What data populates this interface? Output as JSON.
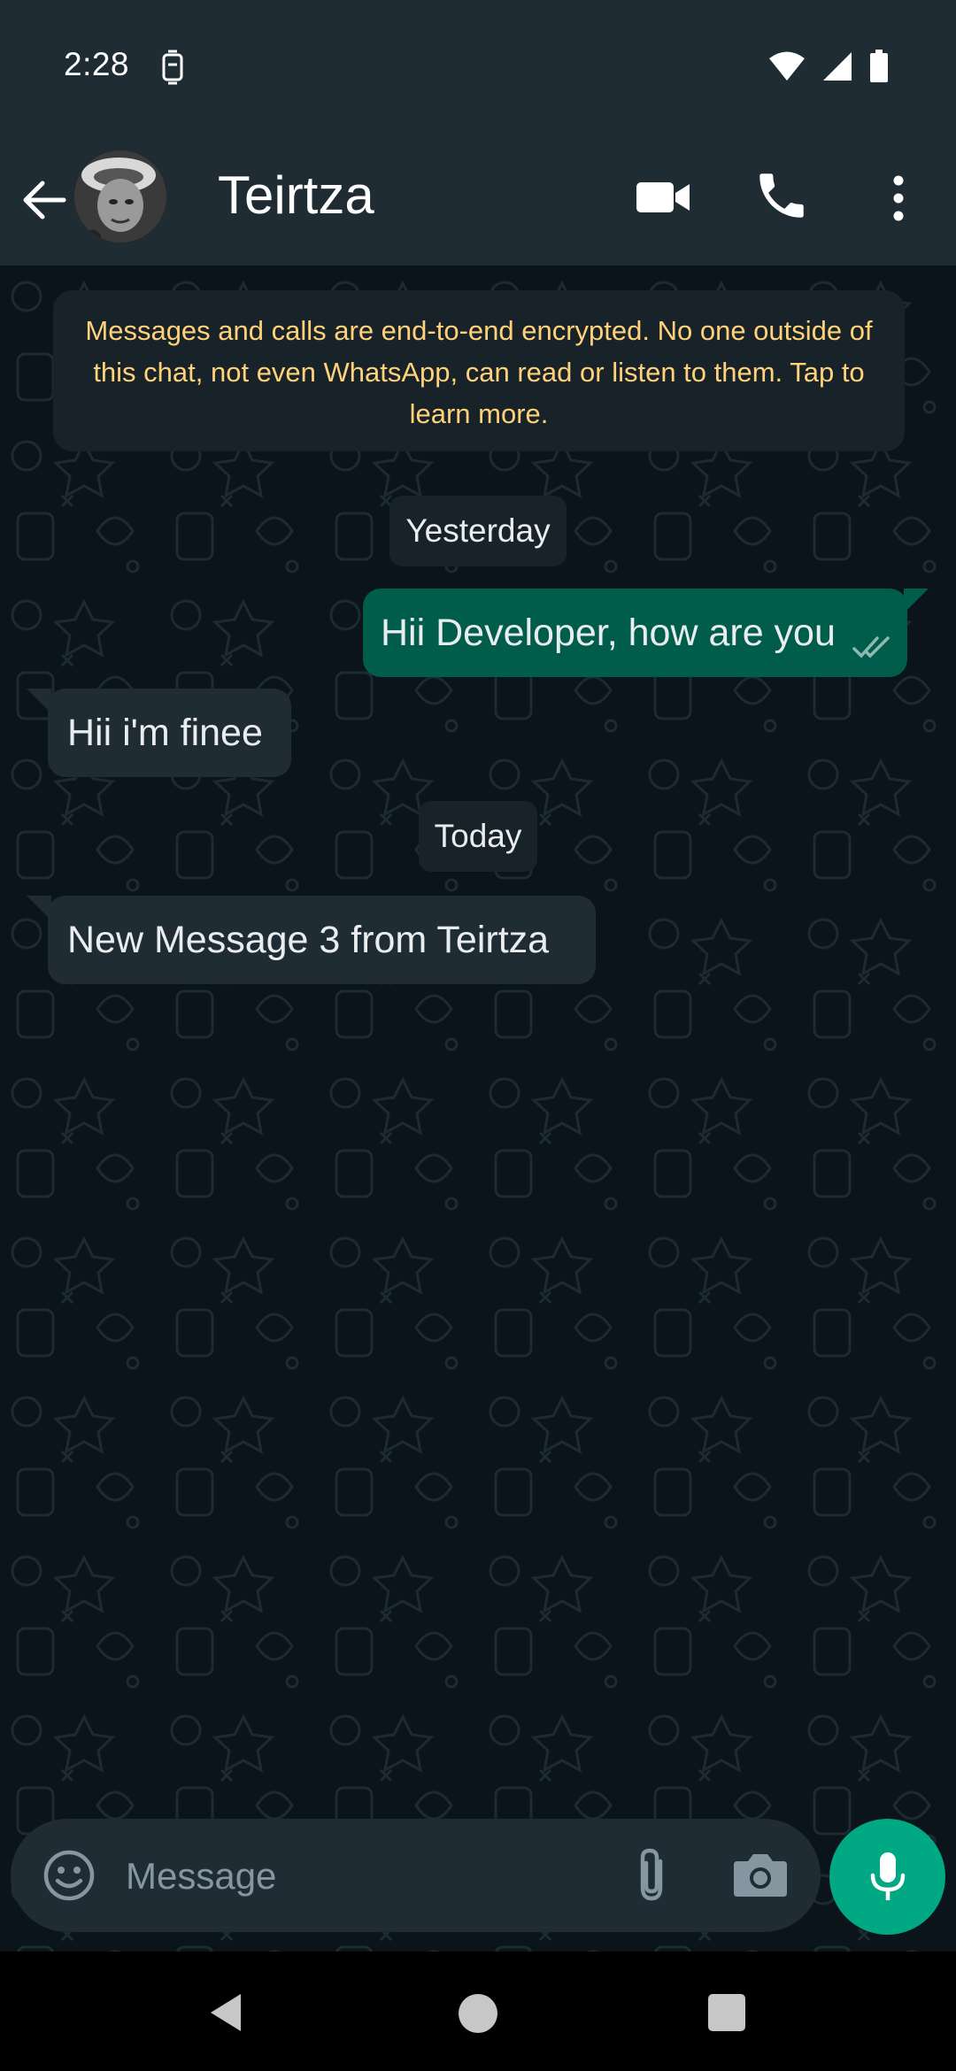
{
  "status_bar": {
    "time": "2:28",
    "icons": [
      "notification-icon",
      "wifi-icon",
      "signal-icon",
      "battery-icon"
    ]
  },
  "header": {
    "contact_name": "Teirtza",
    "icons": [
      "back-arrow-icon",
      "avatar",
      "video-call-icon",
      "phone-icon",
      "more-vert-icon"
    ]
  },
  "chat": {
    "encryption_notice": "Messages and calls are end-to-end encrypted. No one outside of this chat, not even WhatsApp, can read or listen to them. Tap to learn more.",
    "dates": {
      "yesterday": "Yesterday",
      "today": "Today"
    },
    "messages": [
      {
        "direction": "outgoing",
        "text": "Hii Developer, how are you",
        "status": "read"
      },
      {
        "direction": "incoming",
        "text": "Hii i'm finee"
      },
      {
        "direction": "incoming",
        "text": "New Message 3 from Teirtza"
      }
    ]
  },
  "composer": {
    "placeholder": "Message",
    "value": "",
    "icons": [
      "emoji-icon",
      "attach-icon",
      "camera-icon",
      "mic-icon"
    ]
  },
  "colors": {
    "app_bar": "#1f2c34",
    "chat_bg": "#0b141a",
    "outgoing_bubble": "#005c4b",
    "incoming_bubble": "#202c33",
    "accent": "#00a884",
    "encryption_text": "#ffd279"
  }
}
